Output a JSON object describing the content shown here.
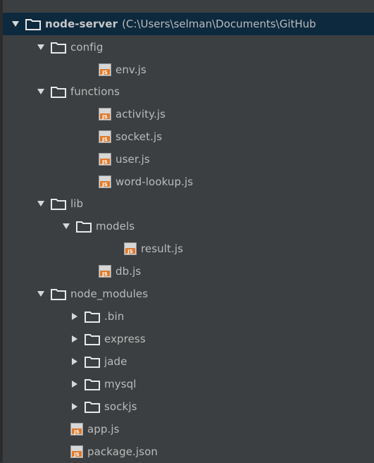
{
  "project_tree": {
    "root": {
      "name": "node-server",
      "path": "(C:\\Users\\selman\\Documents\\GitHub"
    },
    "items": [
      {
        "label": "config",
        "type": "folder",
        "expanded": true
      },
      {
        "label": "env.js",
        "type": "js"
      },
      {
        "label": "functions",
        "type": "folder",
        "expanded": true
      },
      {
        "label": "activity.js",
        "type": "js"
      },
      {
        "label": "socket.js",
        "type": "js"
      },
      {
        "label": "user.js",
        "type": "js"
      },
      {
        "label": "word-lookup.js",
        "type": "js"
      },
      {
        "label": "lib",
        "type": "folder",
        "expanded": true
      },
      {
        "label": "models",
        "type": "folder",
        "expanded": true
      },
      {
        "label": "result.js",
        "type": "js"
      },
      {
        "label": "db.js",
        "type": "js"
      },
      {
        "label": "node_modules",
        "type": "folder",
        "expanded": true
      },
      {
        "label": ".bin",
        "type": "folder",
        "expanded": false
      },
      {
        "label": "express",
        "type": "folder",
        "expanded": false
      },
      {
        "label": "jade",
        "type": "folder",
        "expanded": false
      },
      {
        "label": "mysql",
        "type": "folder",
        "expanded": false
      },
      {
        "label": "sockjs",
        "type": "folder",
        "expanded": false
      },
      {
        "label": "app.js",
        "type": "js"
      },
      {
        "label": "package.json",
        "type": "js"
      }
    ]
  },
  "icons": {
    "expanded_arrow": "triangle-down-icon",
    "collapsed_arrow": "triangle-right-icon",
    "folder": "folder-icon",
    "js_file": "js-file-icon"
  },
  "colors": {
    "background": "#3c3f41",
    "selection": "#0d293e",
    "text": "#bbbbbb",
    "folder": "#e8e8e8",
    "js_icon": "#e07a2e"
  }
}
